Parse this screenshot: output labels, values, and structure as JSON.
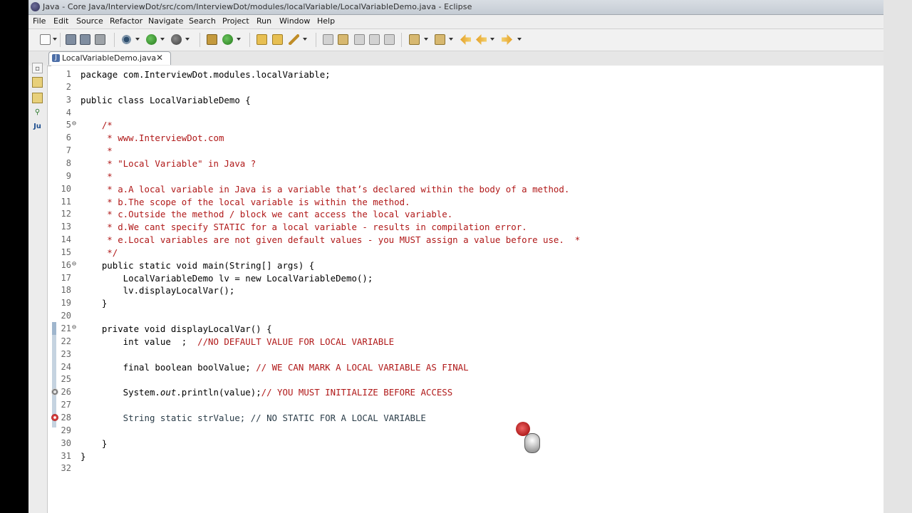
{
  "window": {
    "title": "Java - Core Java/InterviewDot/src/com/InterviewDot/modules/localVariable/LocalVariableDemo.java - Eclipse"
  },
  "menu": {
    "items": [
      "File",
      "Edit",
      "Source",
      "Refactor",
      "Navigate",
      "Search",
      "Project",
      "Run",
      "Window",
      "Help"
    ]
  },
  "toolbar": {
    "icons": [
      "new-file-icon",
      "save-icon",
      "save-all-icon",
      "print-icon",
      "debug-gear-icon",
      "run-icon",
      "external-tools-icon",
      "new-package-icon",
      "new-class-icon",
      "open-type-icon",
      "open-folder-icon",
      "search-pencil-icon",
      "toggle-mark-icon",
      "highlight-icon",
      "toggle-block-icon",
      "show-whitespace-icon",
      "next-annotation-icon",
      "prev-annotation-icon",
      "back-icon",
      "forward-icon"
    ]
  },
  "editor_tab": {
    "icon_letter": "J",
    "label": "LocalVariableDemo.java",
    "close": "✕"
  },
  "side_panel": {
    "icons": [
      "restore-icon",
      "hierarchy-icon",
      "package-explorer-icon",
      "type-hierarchy-icon",
      "junit-icon"
    ],
    "junit_label": "Ju"
  },
  "code": {
    "lines": [
      {
        "n": "1",
        "text": "package com.InterviewDot.modules.localVariable;"
      },
      {
        "n": "2",
        "text": ""
      },
      {
        "n": "3",
        "text": "public class LocalVariableDemo {"
      },
      {
        "n": "4",
        "text": ""
      },
      {
        "n": "5",
        "fold": "⊖",
        "text": "    /*"
      },
      {
        "n": "6",
        "text": "     * www.InterviewDot.com"
      },
      {
        "n": "7",
        "text": "     *"
      },
      {
        "n": "8",
        "text": "     * \"Local Variable\" in Java ?"
      },
      {
        "n": "9",
        "text": "     *"
      },
      {
        "n": "10",
        "text": "     * a.A local variable in Java is a variable that’s declared within the body of a method."
      },
      {
        "n": "11",
        "text": "     * b.The scope of the local variable is within the method."
      },
      {
        "n": "12",
        "text": "     * c.Outside the method / block we cant access the local variable."
      },
      {
        "n": "13",
        "text": "     * d.We cant specify STATIC for a local variable - results in compilation error."
      },
      {
        "n": "14",
        "text": "     * e.Local variables are not given default values - you MUST assign a value before use.  *"
      },
      {
        "n": "15",
        "text": "     */"
      },
      {
        "n": "16",
        "fold": "⊖",
        "text": "    public static void main(String[] args) {"
      },
      {
        "n": "17",
        "text": "        LocalVariableDemo lv = new LocalVariableDemo();"
      },
      {
        "n": "18",
        "text": "        lv.displayLocalVar();"
      },
      {
        "n": "19",
        "text": "    }"
      },
      {
        "n": "20",
        "text": ""
      },
      {
        "n": "21",
        "fold": "⊖",
        "text": "    private void displayLocalVar() {"
      },
      {
        "n": "22",
        "code": "        int value  ;  ",
        "comment": "//NO DEFAULT VALUE FOR LOCAL VARIABLE"
      },
      {
        "n": "23",
        "text": ""
      },
      {
        "n": "24",
        "code": "        final boolean boolValue; ",
        "comment": "// WE CAN MARK A LOCAL VARIABLE AS FINAL"
      },
      {
        "n": "25",
        "text": ""
      },
      {
        "n": "26",
        "code_pre": "        System.",
        "code_ital": "out",
        "code_post": ".println(value);",
        "comment": "// YOU MUST INITIALIZE BEFORE ACCESS"
      },
      {
        "n": "27",
        "text": ""
      },
      {
        "n": "28",
        "text": "        String static strValue; // NO STATIC FOR A LOCAL VARIABLE"
      },
      {
        "n": "29",
        "text": ""
      },
      {
        "n": "30",
        "text": "    }"
      },
      {
        "n": "31",
        "text": "}"
      },
      {
        "n": "32",
        "text": ""
      }
    ]
  },
  "colors": {
    "comment": "#b01818",
    "selection": "#1b8ef3",
    "line_number": "#666666"
  }
}
